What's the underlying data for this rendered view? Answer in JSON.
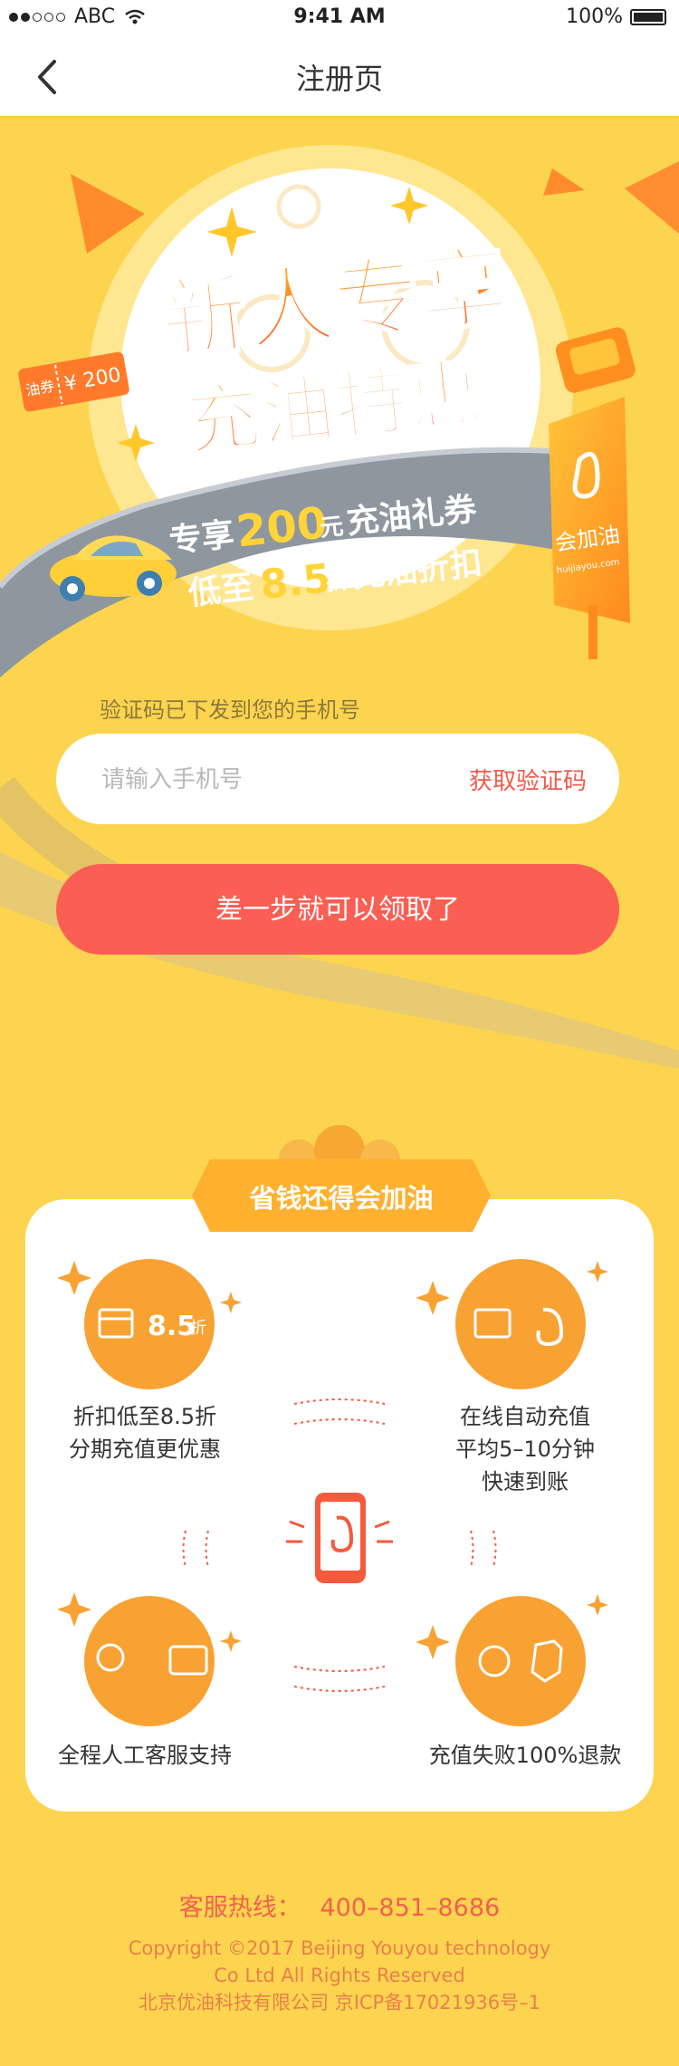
{
  "status_bar": {
    "carrier": "ABC",
    "time": "9:41 AM",
    "battery": "100%"
  },
  "nav": {
    "title": "注册页"
  },
  "hero": {
    "title_line1": "新人专享",
    "title_line2": "充油特惠",
    "coupon_label": "油券",
    "coupon_amount": "¥ 200",
    "sub1_pre": "专享",
    "sub1_num": "200",
    "sub1_unit": "元",
    "sub1_post": "充油礼券",
    "sub2_pre": "低至",
    "sub2_num": "8.5",
    "sub2_unit": "折",
    "sub2_post": "充油折扣",
    "sign_brand": "会加油",
    "sign_url": "huijiayou.com"
  },
  "form": {
    "sms_hint": "验证码已下发到您的手机号",
    "phone_placeholder": "请输入手机号",
    "phone_value": "",
    "get_code": "获取验证码",
    "submit": "差一步就可以领取了"
  },
  "features": {
    "banner": "省钱还得会加油",
    "discount_badge_num": "8.5",
    "discount_badge_unit": "折",
    "items": [
      {
        "line1": "折扣低至8.5折",
        "line2": "分期充值更优惠",
        "line3": ""
      },
      {
        "line1": "在线自动充值",
        "line2": "平均5–10分钟",
        "line3": "快速到账"
      },
      {
        "line1": "全程人工客服支持",
        "line2": "",
        "line3": ""
      },
      {
        "line1": "充值失败100%退款",
        "line2": "",
        "line3": ""
      }
    ]
  },
  "footer": {
    "hotline_label": "客服热线：",
    "hotline_number": "400–851–8686",
    "copyright_line1": "Copyright ©2017 Beijing Youyou technology",
    "copyright_line2": "Co Ltd All Rights Reserved",
    "copyright_line3": "北京优油科技有限公司 京ICP备17021936号–1"
  },
  "colors": {
    "background": "#FDD44F",
    "accent_red": "#FB5E53",
    "icon_orange": "#F7A233",
    "road_gray": "#8E969F"
  }
}
